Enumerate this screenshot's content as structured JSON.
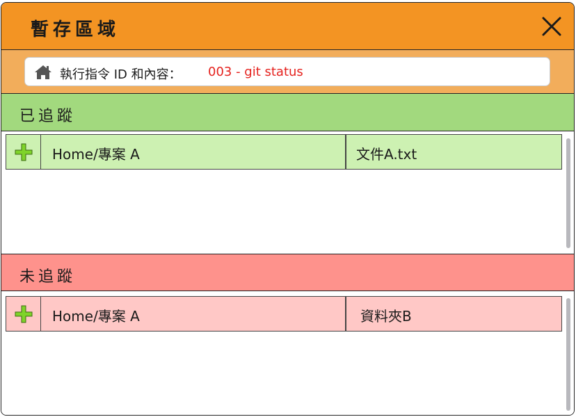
{
  "window": {
    "title": "暫存區域"
  },
  "command": {
    "label": "執行指令 ID 和內容：",
    "value": "003 - git status"
  },
  "tracked": {
    "title": "已追蹤",
    "rows": [
      {
        "path": "Home/專案 A",
        "name": "文件A.txt"
      }
    ]
  },
  "untracked": {
    "title": "未追蹤",
    "rows": [
      {
        "path": "Home/專案 A",
        "name": "資料夾B"
      }
    ]
  },
  "colors": {
    "titlebar": "#f39423",
    "command_bar": "#f2ad5b",
    "command_value": "#e5211d",
    "tracked_header": "#a2d97e",
    "tracked_row": "#cdf1b2",
    "untracked_header": "#fe928c",
    "untracked_row": "#ffc8c6",
    "add_icon": "#7fd32a"
  },
  "icons": {
    "close": "close-icon",
    "home": "home-icon",
    "add": "plus-icon"
  }
}
